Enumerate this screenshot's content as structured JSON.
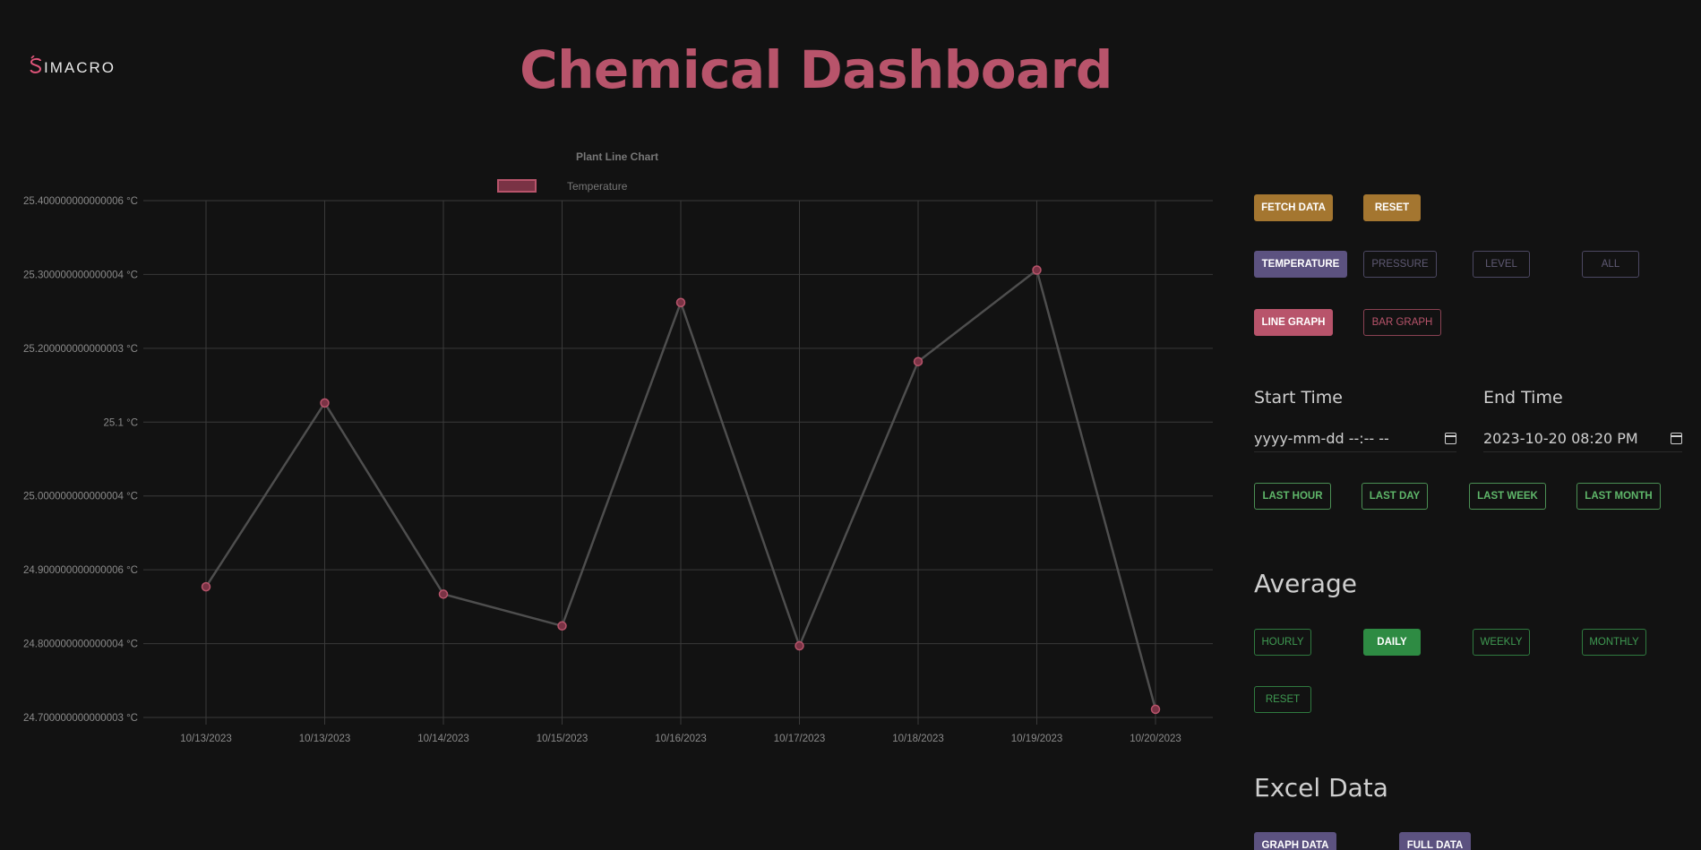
{
  "brand": {
    "logo_text": "IMACRO",
    "logo_letter": "S"
  },
  "page_title": "Chemical Dashboard",
  "controls": {
    "fetch_data": "FETCH DATA",
    "reset": "RESET",
    "metrics": [
      "TEMPERATURE",
      "PRESSURE",
      "LEVEL",
      "ALL"
    ],
    "graph_types": [
      "LINE GRAPH",
      "BAR GRAPH"
    ],
    "start_time_label": "Start Time",
    "start_time_value": "yyyy-mm-dd --:-- --",
    "end_time_label": "End Time",
    "end_time_value": "2023-10-20 08:20 PM",
    "ranges": [
      "LAST HOUR",
      "LAST DAY",
      "LAST WEEK",
      "LAST MONTH"
    ],
    "average_heading": "Average",
    "averages": [
      "HOURLY",
      "DAILY",
      "WEEKLY",
      "MONTHLY"
    ],
    "average_reset": "RESET",
    "excel_heading": "Excel Data",
    "excel_buttons": [
      "GRAPH DATA",
      "FULL DATA"
    ]
  },
  "colors": {
    "accent": "#b8546b",
    "background": "#121212",
    "gold": "#a47630",
    "purple": "#5c5280",
    "green": "#2e8b43"
  },
  "chart_data": {
    "type": "line",
    "title": "Plant Line Chart",
    "legend": "top",
    "series": [
      {
        "name": "Temperature",
        "values": [
          24.877,
          25.126,
          24.867,
          24.824,
          25.262,
          24.797,
          25.182,
          25.306,
          24.711
        ]
      }
    ],
    "x": [
      "10/13/2023",
      "10/13/2023",
      "10/14/2023",
      "10/15/2023",
      "10/16/2023",
      "10/17/2023",
      "10/18/2023",
      "10/19/2023",
      "10/20/2023"
    ],
    "ylim": [
      24.7,
      25.4
    ],
    "y_tick_labels": [
      "25.400000000000006 °C",
      "25.300000000000004 °C",
      "25.200000000000003 °C",
      "25.1 °C",
      "25.000000000000004 °C",
      "24.900000000000006 °C",
      "24.800000000000004 °C",
      "24.700000000000003 °C"
    ],
    "grid": true,
    "line_color": "#4e4e4e",
    "point_color": "#b8546b"
  }
}
